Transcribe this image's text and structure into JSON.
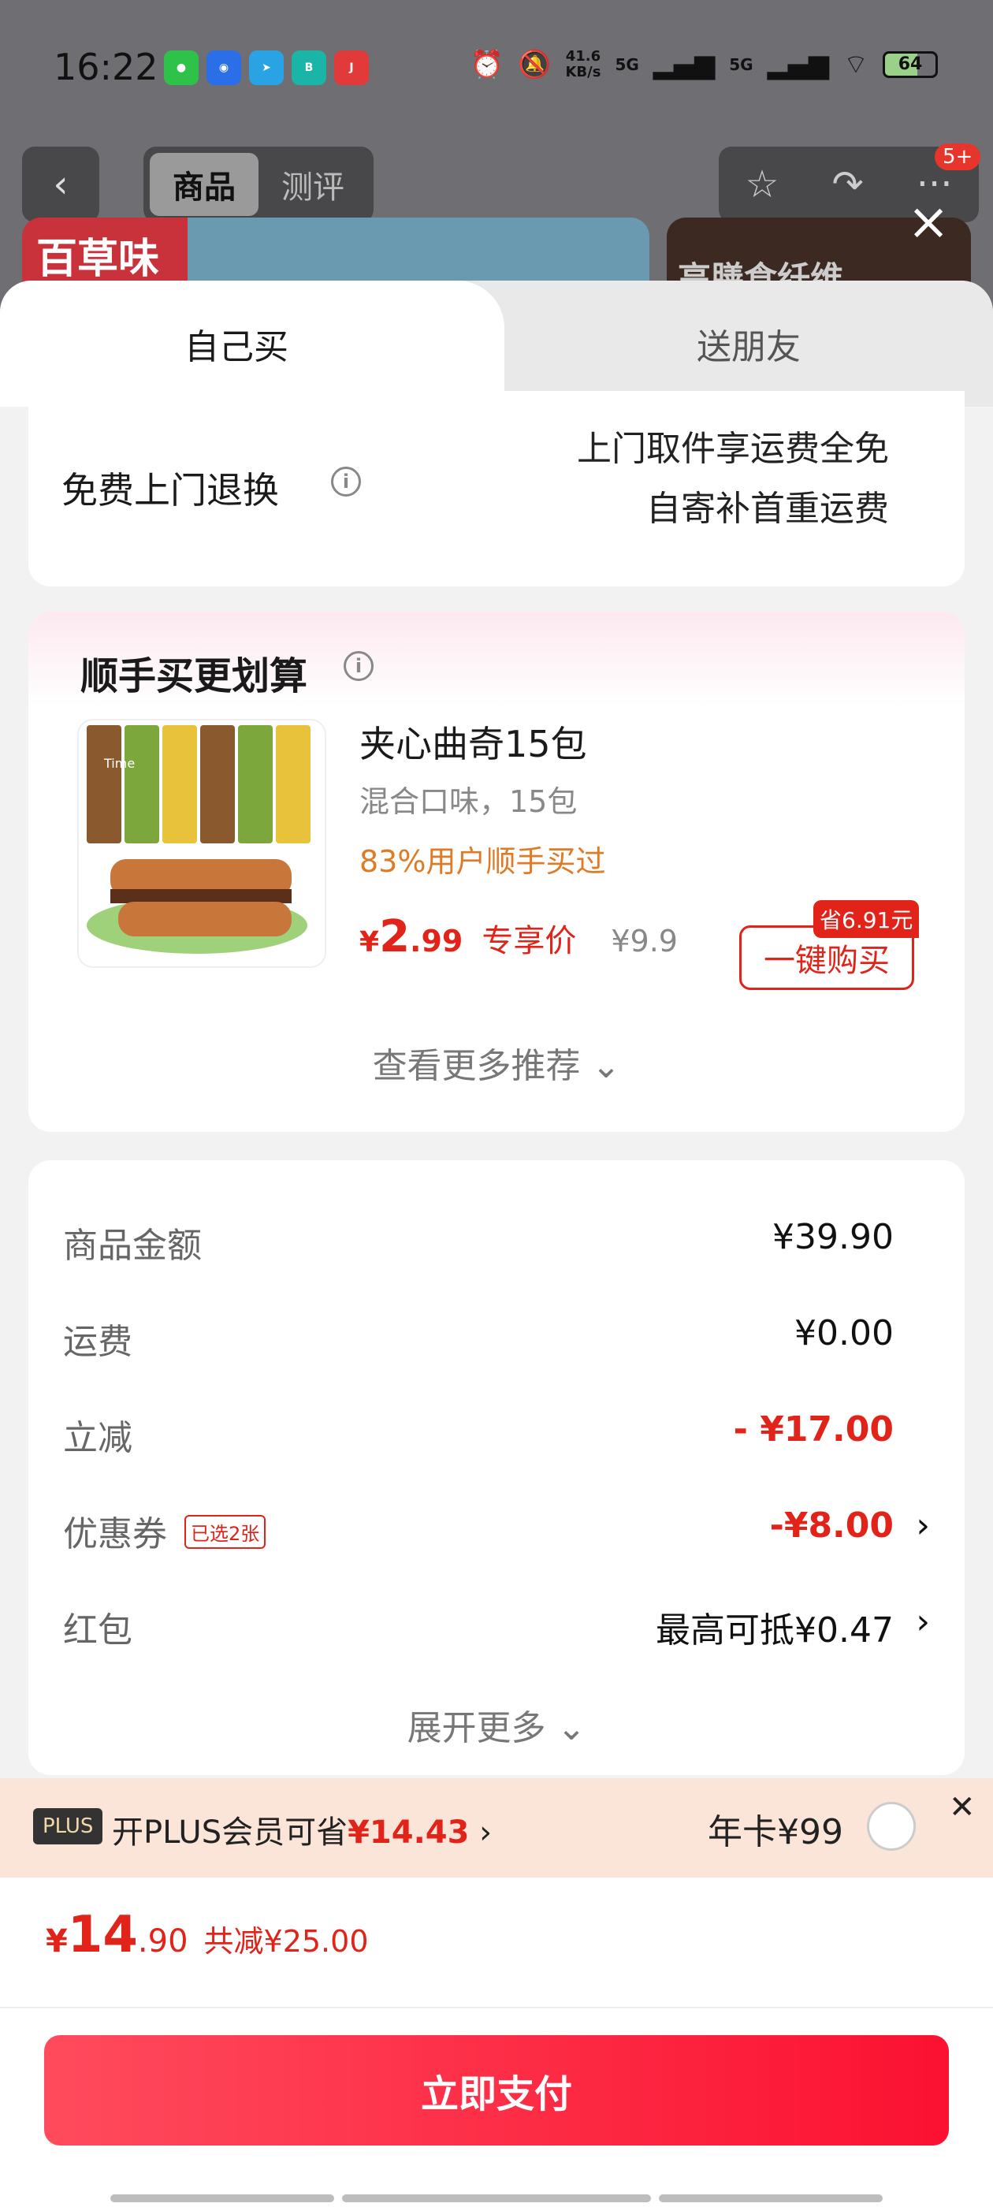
{
  "status_bar": {
    "time": "16:22",
    "net_speed_value": "41.6",
    "net_speed_unit": "KB/s",
    "signal_1": "5G",
    "signal_2": "5G",
    "battery": "64",
    "app_icons": [
      "wechat-icon",
      "app-icon",
      "telegram-icon",
      "boss-icon",
      "jd-icon"
    ]
  },
  "nav": {
    "tabs": [
      "商品",
      "测评"
    ],
    "badge": "5+",
    "banner_left": "百草味",
    "banner_right": "高膳食纤维"
  },
  "sheet_tabs": {
    "self": "自己买",
    "gift": "送朋友"
  },
  "return_card": {
    "label": "免费上门退换",
    "line1": "上门取件享运费全免",
    "line2": "自寄补首重运费"
  },
  "addon": {
    "title": "顺手买更划算",
    "product": {
      "name": "夹心曲奇15包",
      "sub": "混合口味，15包",
      "bought": "83%用户顺手买过",
      "price_yen": "¥",
      "price_int": "2",
      "price_dec": ".99",
      "price_tag": "专享价",
      "orig_price": "¥9.9",
      "save_badge": "省6.91元",
      "buy_label": "一键购买",
      "img_brand": "Time"
    },
    "more": "查看更多推荐"
  },
  "summary": {
    "rows": [
      {
        "label": "商品金额",
        "value": "¥39.90"
      },
      {
        "label": "运费",
        "value": "¥0.00"
      },
      {
        "label": "立减",
        "value": "- ¥17.00"
      },
      {
        "label": "优惠券",
        "tag": "已选2张",
        "value": "-¥8.00"
      },
      {
        "label": "红包",
        "value": "最高可抵¥0.47"
      }
    ],
    "expand": "展开更多"
  },
  "plus": {
    "badge": "PLUS",
    "text": "开PLUS会员可省",
    "amount": "¥14.43",
    "year_card": "年卡¥99"
  },
  "footer": {
    "total_yen": "¥",
    "total_int": "14",
    "total_dec": ".90",
    "total_reduce": "共减¥25.00",
    "pay_label": "立即支付"
  },
  "colors": {
    "accent_red": "#e2231a",
    "pay_gradient_start": "#ff4b5d",
    "pay_gradient_end": "#fb1131",
    "plus_bg": "#fbe5d8",
    "bought_orange": "#e07b25"
  }
}
